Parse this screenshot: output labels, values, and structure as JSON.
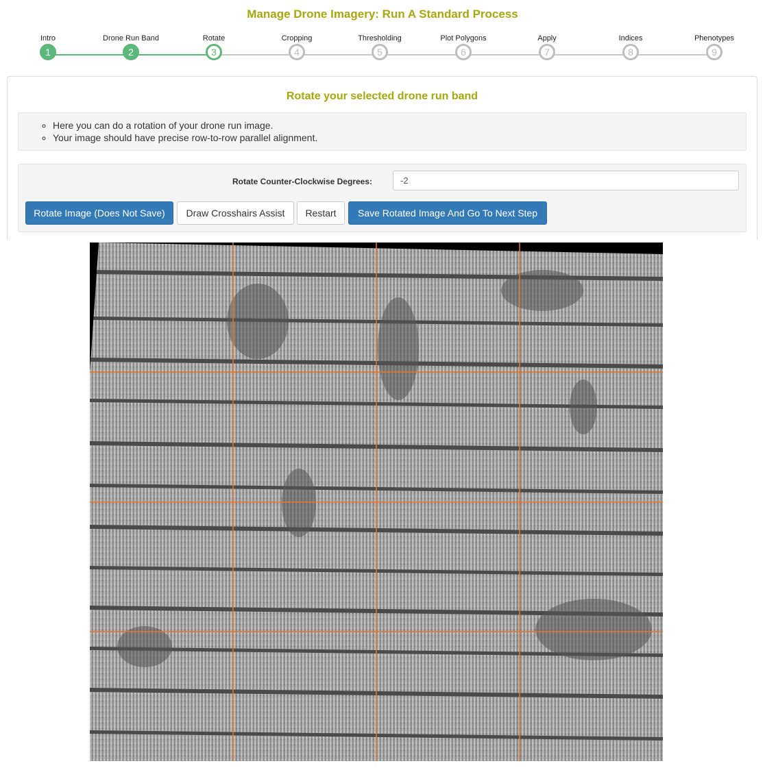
{
  "page": {
    "title": "Manage Drone Imagery: Run A Standard Process"
  },
  "wizard": {
    "steps": [
      {
        "label": "Intro",
        "number": "1",
        "state": "done"
      },
      {
        "label": "Drone Run Band",
        "number": "2",
        "state": "done"
      },
      {
        "label": "Rotate",
        "number": "3",
        "state": "active"
      },
      {
        "label": "Cropping",
        "number": "4",
        "state": "todo"
      },
      {
        "label": "Thresholding",
        "number": "5",
        "state": "todo"
      },
      {
        "label": "Plot Polygons",
        "number": "6",
        "state": "todo"
      },
      {
        "label": "Apply",
        "number": "7",
        "state": "todo"
      },
      {
        "label": "Indices",
        "number": "8",
        "state": "todo"
      },
      {
        "label": "Phenotypes",
        "number": "9",
        "state": "todo"
      }
    ],
    "colors": {
      "done": "#5cb87a",
      "todo": "#bdbdbd"
    }
  },
  "panel": {
    "heading": "Rotate your selected drone run band",
    "instructions": [
      "Here you can do a rotation of your drone run image.",
      "Your image should have precise row-to-row parallel alignment."
    ]
  },
  "rotate_form": {
    "label": "Rotate Counter-Clockwise Degrees:",
    "value": "-2",
    "buttons": {
      "rotate": "Rotate Image (Does Not Save)",
      "crosshairs": "Draw Crosshairs Assist",
      "restart": "Restart",
      "save_next": "Save Rotated Image And Go To Next Step"
    }
  },
  "image": {
    "rotation_degrees": -2,
    "crosshair_color": "#e8742a",
    "crosshair_grid": {
      "columns": 4,
      "rows": 4
    }
  }
}
